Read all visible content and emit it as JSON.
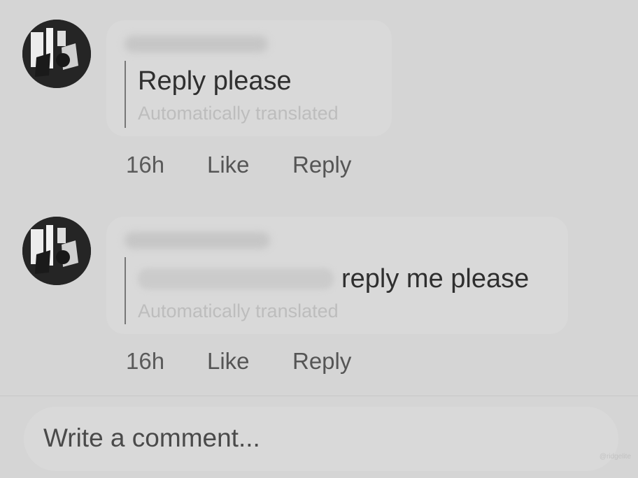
{
  "comments": [
    {
      "text": "Reply please",
      "translated_label": "Automatically translated",
      "time": "16h",
      "like_label": "Like",
      "reply_label": "Reply"
    },
    {
      "text": "reply me please",
      "translated_label": "Automatically translated",
      "time": "16h",
      "like_label": "Like",
      "reply_label": "Reply"
    }
  ],
  "composer": {
    "placeholder": "Write a comment..."
  },
  "watermark": "@ridgelite",
  "colors": {
    "background": "#d5d5d5",
    "bubble": "#d9d9d9",
    "avatar": "#262626"
  },
  "icons": {
    "avatar": "profile-photo"
  }
}
